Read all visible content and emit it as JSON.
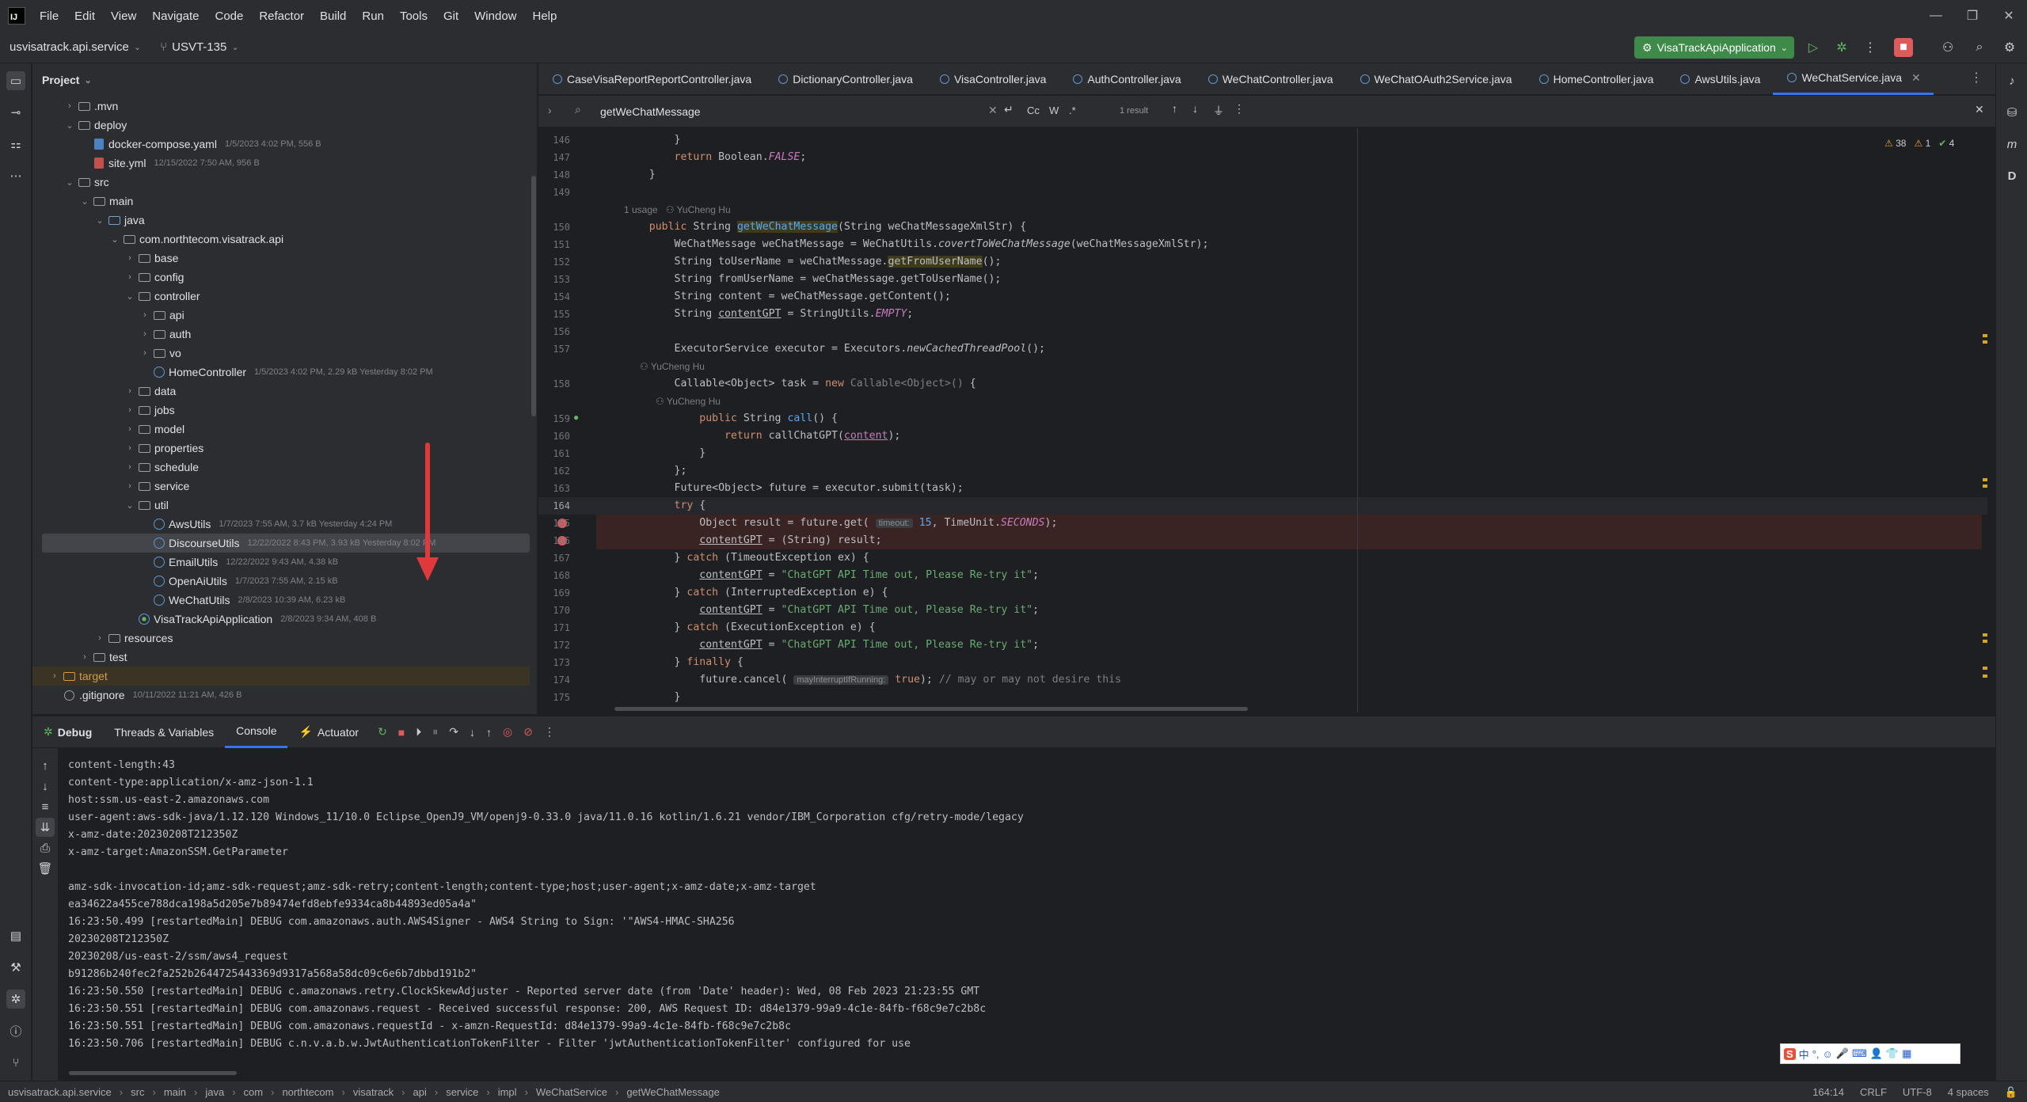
{
  "menubar": {
    "items": [
      "File",
      "Edit",
      "View",
      "Navigate",
      "Code",
      "Refactor",
      "Build",
      "Run",
      "Tools",
      "Git",
      "Window",
      "Help"
    ]
  },
  "toolbar": {
    "project_name": "usvisatrack.api.service",
    "branch": "USVT-135",
    "run_config": "VisaTrackApiApplication"
  },
  "project_panel": {
    "title": "Project",
    "tree": [
      {
        "label": ".mvn",
        "meta": "",
        "type": "folder",
        "depth": 1,
        "arrow": "›"
      },
      {
        "label": "deploy",
        "meta": "",
        "type": "folder",
        "depth": 1,
        "arrow": "⌄"
      },
      {
        "label": "docker-compose.yaml",
        "meta": "1/5/2023 4:02 PM, 556 B",
        "type": "yaml",
        "depth": 2,
        "arrow": ""
      },
      {
        "label": "site.yml",
        "meta": "12/15/2022 7:50 AM, 956 B",
        "type": "yml",
        "depth": 2,
        "arrow": ""
      },
      {
        "label": "src",
        "meta": "",
        "type": "folder",
        "depth": 1,
        "arrow": "⌄"
      },
      {
        "label": "main",
        "meta": "",
        "type": "folder",
        "depth": 2,
        "arrow": "⌄"
      },
      {
        "label": "java",
        "meta": "",
        "type": "src",
        "depth": 3,
        "arrow": "⌄"
      },
      {
        "label": "com.northtecom.visatrack.api",
        "meta": "",
        "type": "pkg",
        "depth": 4,
        "arrow": "⌄"
      },
      {
        "label": "base",
        "meta": "",
        "type": "pkg",
        "depth": 5,
        "arrow": "›"
      },
      {
        "label": "config",
        "meta": "",
        "type": "pkg",
        "depth": 5,
        "arrow": "›"
      },
      {
        "label": "controller",
        "meta": "",
        "type": "pkg",
        "depth": 5,
        "arrow": "⌄"
      },
      {
        "label": "api",
        "meta": "",
        "type": "pkg",
        "depth": 6,
        "arrow": "›"
      },
      {
        "label": "auth",
        "meta": "",
        "type": "pkg",
        "depth": 6,
        "arrow": "›"
      },
      {
        "label": "vo",
        "meta": "",
        "type": "pkg",
        "depth": 6,
        "arrow": "›"
      },
      {
        "label": "HomeController",
        "meta": "1/5/2023 4:02 PM, 2.29 kB Yesterday 8:02 PM",
        "type": "class",
        "depth": 6,
        "arrow": ""
      },
      {
        "label": "data",
        "meta": "",
        "type": "pkg",
        "depth": 5,
        "arrow": "›"
      },
      {
        "label": "jobs",
        "meta": "",
        "type": "pkg",
        "depth": 5,
        "arrow": "›"
      },
      {
        "label": "model",
        "meta": "",
        "type": "pkg",
        "depth": 5,
        "arrow": "›"
      },
      {
        "label": "properties",
        "meta": "",
        "type": "pkg",
        "depth": 5,
        "arrow": "›"
      },
      {
        "label": "schedule",
        "meta": "",
        "type": "pkg",
        "depth": 5,
        "arrow": "›"
      },
      {
        "label": "service",
        "meta": "",
        "type": "pkg",
        "depth": 5,
        "arrow": "›"
      },
      {
        "label": "util",
        "meta": "",
        "type": "pkg",
        "depth": 5,
        "arrow": "⌄"
      },
      {
        "label": "AwsUtils",
        "meta": "1/7/2023 7:55 AM, 3.7 kB Yesterday 4:24 PM",
        "type": "class",
        "depth": 6,
        "arrow": ""
      },
      {
        "label": "DiscourseUtils",
        "meta": "12/22/2022 8:43 PM, 3.93 kB Yesterday 8:02 PM",
        "type": "class",
        "depth": 6,
        "arrow": "",
        "selected": true
      },
      {
        "label": "EmailUtils",
        "meta": "12/22/2022 9:43 AM, 4.38 kB",
        "type": "class",
        "depth": 6,
        "arrow": ""
      },
      {
        "label": "OpenAiUtils",
        "meta": "1/7/2023 7:55 AM, 2.15 kB",
        "type": "class",
        "depth": 6,
        "arrow": ""
      },
      {
        "label": "WeChatUtils",
        "meta": "2/8/2023 10:39 AM, 6.23 kB",
        "type": "class",
        "depth": 6,
        "arrow": ""
      },
      {
        "label": "VisaTrackApiApplication",
        "meta": "2/8/2023 9:34 AM, 408 B",
        "type": "boot",
        "depth": 5,
        "arrow": ""
      },
      {
        "label": "resources",
        "meta": "",
        "type": "folder",
        "depth": 3,
        "arrow": "›"
      },
      {
        "label": "test",
        "meta": "",
        "type": "folder",
        "depth": 2,
        "arrow": "›"
      },
      {
        "label": "target",
        "meta": "",
        "type": "target",
        "depth": 0,
        "arrow": "›",
        "target": true
      },
      {
        "label": ".gitignore",
        "meta": "10/11/2022 11:21 AM, 426 B",
        "type": "git",
        "depth": 0,
        "arrow": ""
      }
    ]
  },
  "editor": {
    "tabs": [
      {
        "label": "CaseVisaReportReportController.java",
        "active": false
      },
      {
        "label": "DictionaryController.java",
        "active": false
      },
      {
        "label": "VisaController.java",
        "active": false
      },
      {
        "label": "AuthController.java",
        "active": false
      },
      {
        "label": "WeChatController.java",
        "active": false
      },
      {
        "label": "WeChatOAuth2Service.java",
        "active": false
      },
      {
        "label": "HomeController.java",
        "active": false
      },
      {
        "label": "AwsUtils.java",
        "active": false
      },
      {
        "label": "WeChatService.java",
        "active": true
      }
    ],
    "search": {
      "query": "getWeChatMessage",
      "result": "1 result",
      "opts": [
        "Cc",
        "W",
        ".*"
      ]
    },
    "inspections": {
      "warnings": "38",
      "weak": "1",
      "ok": "4"
    },
    "usages_label": "1 usage",
    "author": "YuCheng Hu",
    "lines": [
      {
        "n": "146",
        "html": "        }"
      },
      {
        "n": "147",
        "html": "        <span class=\"kw\">return</span> Boolean.<span class=\"fld it\">FALSE</span>;"
      },
      {
        "n": "148",
        "html": "    }"
      },
      {
        "n": "149",
        "html": ""
      },
      {
        "n": "150",
        "html": "    <span class=\"kw\">public</span> String <span class=\"fn hl-word\">getWeChatMessage</span>(String weChatMessageXmlStr) {"
      },
      {
        "n": "151",
        "html": "        WeChatMessage weChatMessage = WeChatUtils.<span class=\"it\">covertToWeChatMessage</span>(weChatMessageXmlStr);"
      },
      {
        "n": "152",
        "html": "        String toUserName = weChatMessage.<span class=\"hl-word\">getFromUserName</span>();"
      },
      {
        "n": "153",
        "html": "        String fromUserName = weChatMessage.getToUserName();"
      },
      {
        "n": "154",
        "html": "        String content = weChatMessage.getContent();"
      },
      {
        "n": "155",
        "html": "        String <span style=\"text-decoration:underline\">contentGPT</span> = StringUtils.<span class=\"fld it\">EMPTY</span>;"
      },
      {
        "n": "156",
        "html": ""
      },
      {
        "n": "157",
        "html": "        ExecutorService executor = Executors.<span class=\"it\">newCachedThreadPool</span>();"
      },
      {
        "n": "158",
        "html": "        Callable&lt;Object&gt; task = <span class=\"kw\">new</span> <span class=\"cm\">Callable&lt;Object&gt;()</span> {"
      },
      {
        "n": "159",
        "html": "            <span class=\"kw\">public</span> String <span class=\"fn\">call</span>() {"
      },
      {
        "n": "160",
        "html": "                <span class=\"kw\">return</span> callChatGPT(<span class=\"fld\" style=\"text-decoration:underline\">content</span>);"
      },
      {
        "n": "161",
        "html": "            }"
      },
      {
        "n": "162",
        "html": "        };"
      },
      {
        "n": "163",
        "html": "        Future&lt;Object&gt; future = executor.submit(task);"
      },
      {
        "n": "164",
        "html": "        <span class=\"kw\">try</span> {"
      },
      {
        "n": "165",
        "html": "            Object result = future.get( <span class=\"hint\">timeout:</span> <span class=\"fn\">15</span>, TimeUnit.<span class=\"fld it\">SECONDS</span>);"
      },
      {
        "n": "166",
        "html": "            <span style=\"text-decoration:underline\">contentGPT</span> = (String) result;"
      },
      {
        "n": "167",
        "html": "        } <span class=\"kw\">catch</span> (TimeoutException ex) {"
      },
      {
        "n": "168",
        "html": "            <span style=\"text-decoration:underline\">contentGPT</span> = <span class=\"str\">\"ChatGPT API Time out, Please Re-try it\"</span>;"
      },
      {
        "n": "169",
        "html": "        } <span class=\"kw\">catch</span> (InterruptedException e) {"
      },
      {
        "n": "170",
        "html": "            <span style=\"text-decoration:underline\">contentGPT</span> = <span class=\"str\">\"ChatGPT API Time out, Please Re-try it\"</span>;"
      },
      {
        "n": "171",
        "html": "        } <span class=\"kw\">catch</span> (ExecutionException e) {"
      },
      {
        "n": "172",
        "html": "            <span style=\"text-decoration:underline\">contentGPT</span> = <span class=\"str\">\"ChatGPT API Time out, Please Re-try it\"</span>;"
      },
      {
        "n": "173",
        "html": "        } <span class=\"kw\">finally</span> {"
      },
      {
        "n": "174",
        "html": "            future.cancel( <span class=\"hint\">mayInterruptIfRunning:</span> <span class=\"kw\">true</span>); <span class=\"cm\">// may or may not desire this</span>"
      },
      {
        "n": "175",
        "html": "        }"
      }
    ]
  },
  "debug": {
    "tabs": [
      "Debug",
      "Threads & Variables",
      "Console",
      "Actuator"
    ],
    "active_tab": "Console",
    "console_lines": [
      "content-length:43",
      "content-type:application/x-amz-json-1.1",
      "host:ssm.us-east-2.amazonaws.com",
      "user-agent:aws-sdk-java/1.12.120 Windows_11/10.0 Eclipse_OpenJ9_VM/openj9-0.33.0 java/11.0.16 kotlin/1.6.21 vendor/IBM_Corporation cfg/retry-mode/legacy",
      "x-amz-date:20230208T212350Z",
      "x-amz-target:AmazonSSM.GetParameter",
      "",
      "amz-sdk-invocation-id;amz-sdk-request;amz-sdk-retry;content-length;content-type;host;user-agent;x-amz-date;x-amz-target",
      "ea34622a455ce788dca198a5d205e7b89474efd8ebfe9334ca8b44893ed05a4a\"",
      "16:23:50.499 [restartedMain] DEBUG com.amazonaws.auth.AWS4Signer - AWS4 String to Sign: '\"AWS4-HMAC-SHA256",
      "20230208T212350Z",
      "20230208/us-east-2/ssm/aws4_request",
      "b91286b240fec2fa252b2644725443369d9317a568a58dc09c6e6b7dbbd191b2\"",
      "16:23:50.550 [restartedMain] DEBUG c.amazonaws.retry.ClockSkewAdjuster - Reported server date (from 'Date' header): Wed, 08 Feb 2023 21:23:55 GMT",
      "16:23:50.551 [restartedMain] DEBUG com.amazonaws.request - Received successful response: 200, AWS Request ID: d84e1379-99a9-4c1e-84fb-f68c9e7c2b8c",
      "16:23:50.551 [restartedMain] DEBUG com.amazonaws.requestId - x-amzn-RequestId: d84e1379-99a9-4c1e-84fb-f68c9e7c2b8c",
      "16:23:50.706 [restartedMain] DEBUG c.n.v.a.b.w.JwtAuthenticationTokenFilter - Filter 'jwtAuthenticationTokenFilter' configured for use"
    ]
  },
  "statusbar": {
    "breadcrumbs": [
      "usvisatrack.api.service",
      "src",
      "main",
      "java",
      "com",
      "northtecom",
      "visatrack",
      "api",
      "service",
      "impl",
      "WeChatService",
      "getWeChatMessage"
    ],
    "position": "164:14",
    "line_sep": "CRLF",
    "encoding": "UTF-8",
    "indent": "4 spaces"
  },
  "ime": {
    "label": "中"
  },
  "colors": {
    "accent": "#3574f0",
    "run_green": "#3d8a49",
    "stop_red": "#db5c5c",
    "breakpoint": "#db5c5c"
  }
}
